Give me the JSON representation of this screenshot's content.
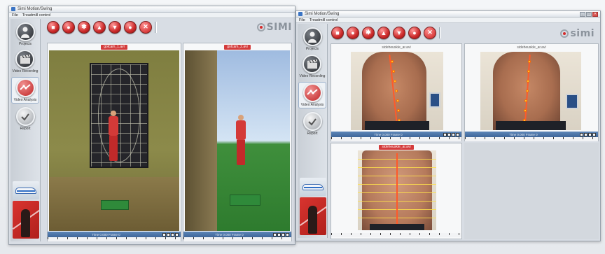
{
  "left_window": {
    "title": "Simi Motion/Swing",
    "menu": [
      "File",
      "Treadmill control"
    ],
    "nav": [
      {
        "label": "Projects",
        "icon": "user-icon"
      },
      {
        "label": "Video Recording",
        "icon": "film-clapper-icon"
      },
      {
        "label": "Video Analysis",
        "icon": "analysis-icon"
      },
      {
        "label": "Report",
        "icon": "report-check-icon"
      }
    ],
    "logo_text": "SIMI",
    "panels": [
      {
        "title": "golcam_1.avi",
        "time": "Time 0.000 Frame 0"
      },
      {
        "title": "golcam_2.avi",
        "time": "Time 0.000 Frame 0"
      }
    ]
  },
  "right_window": {
    "title": "Simi Motion/Swing",
    "menu": [
      "File",
      "Treadmill control"
    ],
    "nav": [
      {
        "label": "Projects",
        "icon": "user-icon"
      },
      {
        "label": "Video Recording",
        "icon": "film-clapper-icon"
      },
      {
        "label": "Video Analysis",
        "icon": "analysis-icon"
      },
      {
        "label": "Report",
        "icon": "report-check-icon"
      }
    ],
    "logo_text": "simi",
    "panels": [
      {
        "title": "sideheuskle_ar.avi",
        "time": "Time 0.000 Frame 0"
      },
      {
        "title": "sideheuskle_ar.avi",
        "time": "Time 0.000 Frame 0"
      },
      {
        "title": "sideheuskle_ar.avi",
        "time": ""
      }
    ]
  },
  "colors": {
    "accent_red": "#d43b3b",
    "timeline_blue": "#4b73a6"
  }
}
